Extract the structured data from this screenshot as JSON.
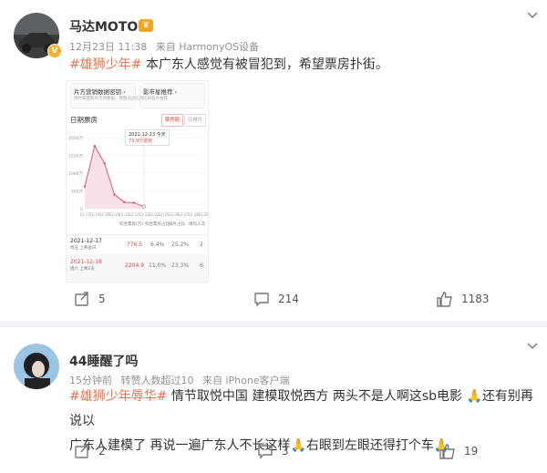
{
  "posts": [
    {
      "user": "马达MOTOR",
      "time": "12月23日 11:38",
      "source": "来自 HarmonyOS设备",
      "tag": "#雄狮少年#",
      "text": " 本广东人感觉有被冒犯到，希望票房扑街。",
      "actions": {
        "repost": "5",
        "comment": "214",
        "like": "1183"
      },
      "embed": {
        "top_buttons": [
          "片方营销数据密钥 ›",
          "影市星推荐 ›"
        ],
        "top_buttons_sub": [
          "随时掌握影片市场数据、预售竞品信息",
          "优质影片推荐"
        ],
        "section_title": "日期票房",
        "tabs": [
          "票房额",
          "日排片"
        ],
        "tooltip_date": "2021-12-23 今天",
        "tooltip_value": "73.9万票房",
        "y_ticks": [
          "2000万",
          "1500万",
          "1000万",
          "500万",
          "0"
        ],
        "x_ticks": [
          "12-17",
          "12-18",
          "12-19",
          "12-20",
          "12-21",
          "12-22",
          "12-23",
          "12-24",
          "12-25",
          "12-26",
          "12-27",
          "12-28",
          "12-29"
        ],
        "table_headers": [
          "综合票房(万)",
          "综合票房占比",
          "排片占比",
          "场均人次"
        ],
        "rows": [
          {
            "date": "2021-12-17",
            "sub": "周五 上映首日",
            "values": [
              "776.5",
              "6.4%",
              "25.2%",
              "2"
            ]
          },
          {
            "date": "2021-12-18",
            "sub": "周六 上映2天",
            "values": [
              "2204.9",
              "11.0%",
              "23.3%",
              "6"
            ]
          }
        ]
      }
    },
    {
      "user": "44睡醒了吗",
      "time": "15分钟前",
      "source": "转赞人数超过10",
      "source2": "来自 iPhone客户端",
      "tag": "#雄狮少年辱华#",
      "text_line1": " 情节取悦中国 建模取悦西方 两头不是人啊这sb电影 🙏还有别再说以",
      "text_line2": "广东人建模了 再说一遍广东人不长这样🙏右眼到左眼还得打个车🙏",
      "actions": {
        "repost": "2",
        "comment": "3",
        "like": "19"
      }
    }
  ],
  "chart_data": {
    "type": "line",
    "title": "日期票房",
    "x": [
      "12-17",
      "12-18",
      "12-19",
      "12-20",
      "12-21",
      "12-22",
      "12-23"
    ],
    "values": [
      776.5,
      2204.9,
      1600,
      500,
      230,
      210,
      73.9
    ],
    "ylim": [
      0,
      2500
    ]
  },
  "colors": {
    "accent": "#eb7350",
    "chart_line": "#e0587a"
  },
  "icons": [
    "chevron-down-icon",
    "repost-icon",
    "comment-icon",
    "like-icon"
  ]
}
